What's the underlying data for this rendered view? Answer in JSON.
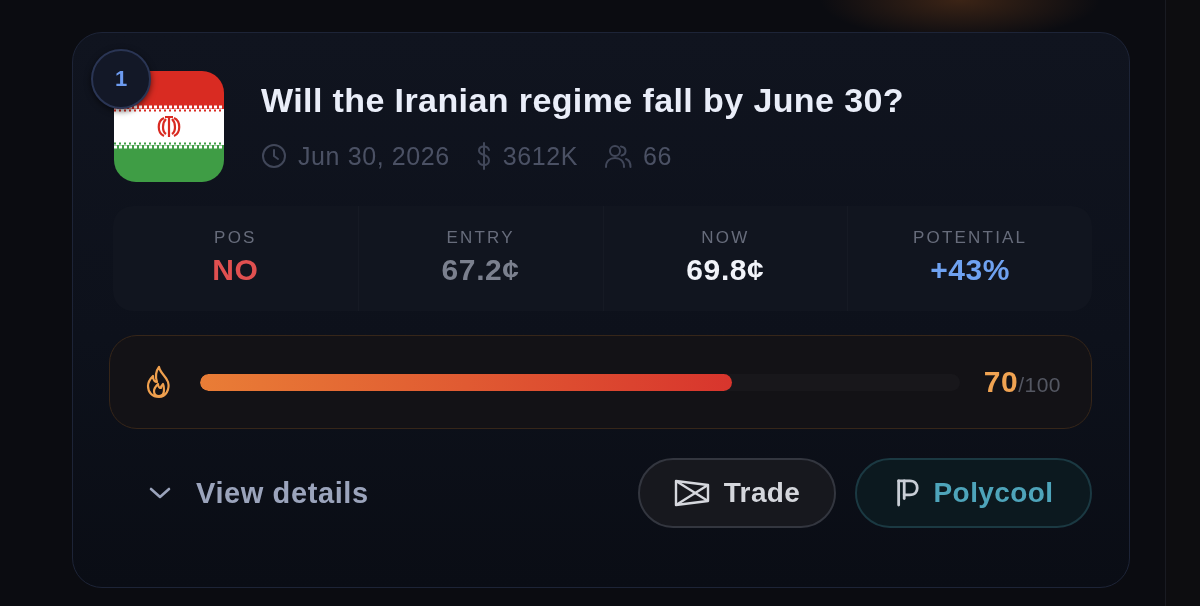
{
  "rank": "1",
  "market": {
    "title": "Will the Iranian regime fall by June 30?",
    "date": "Jun 30, 2026",
    "volume": "3612K",
    "traders": "66"
  },
  "stats": [
    {
      "label": "POS",
      "value": "NO",
      "kind": "position"
    },
    {
      "label": "ENTRY",
      "value": "67.2¢",
      "kind": "entry"
    },
    {
      "label": "NOW",
      "value": "69.8¢",
      "kind": "current"
    },
    {
      "label": "POTENTIAL",
      "value": "+43%",
      "kind": "potential"
    }
  ],
  "score": {
    "level": 0.7,
    "value": "70",
    "max": "/100"
  },
  "details": {
    "label": "View details",
    "expanded": false
  },
  "actions": [
    {
      "label": "Trade",
      "kind": "trade"
    },
    {
      "label": "Polycool",
      "kind": "polycool"
    }
  ]
}
